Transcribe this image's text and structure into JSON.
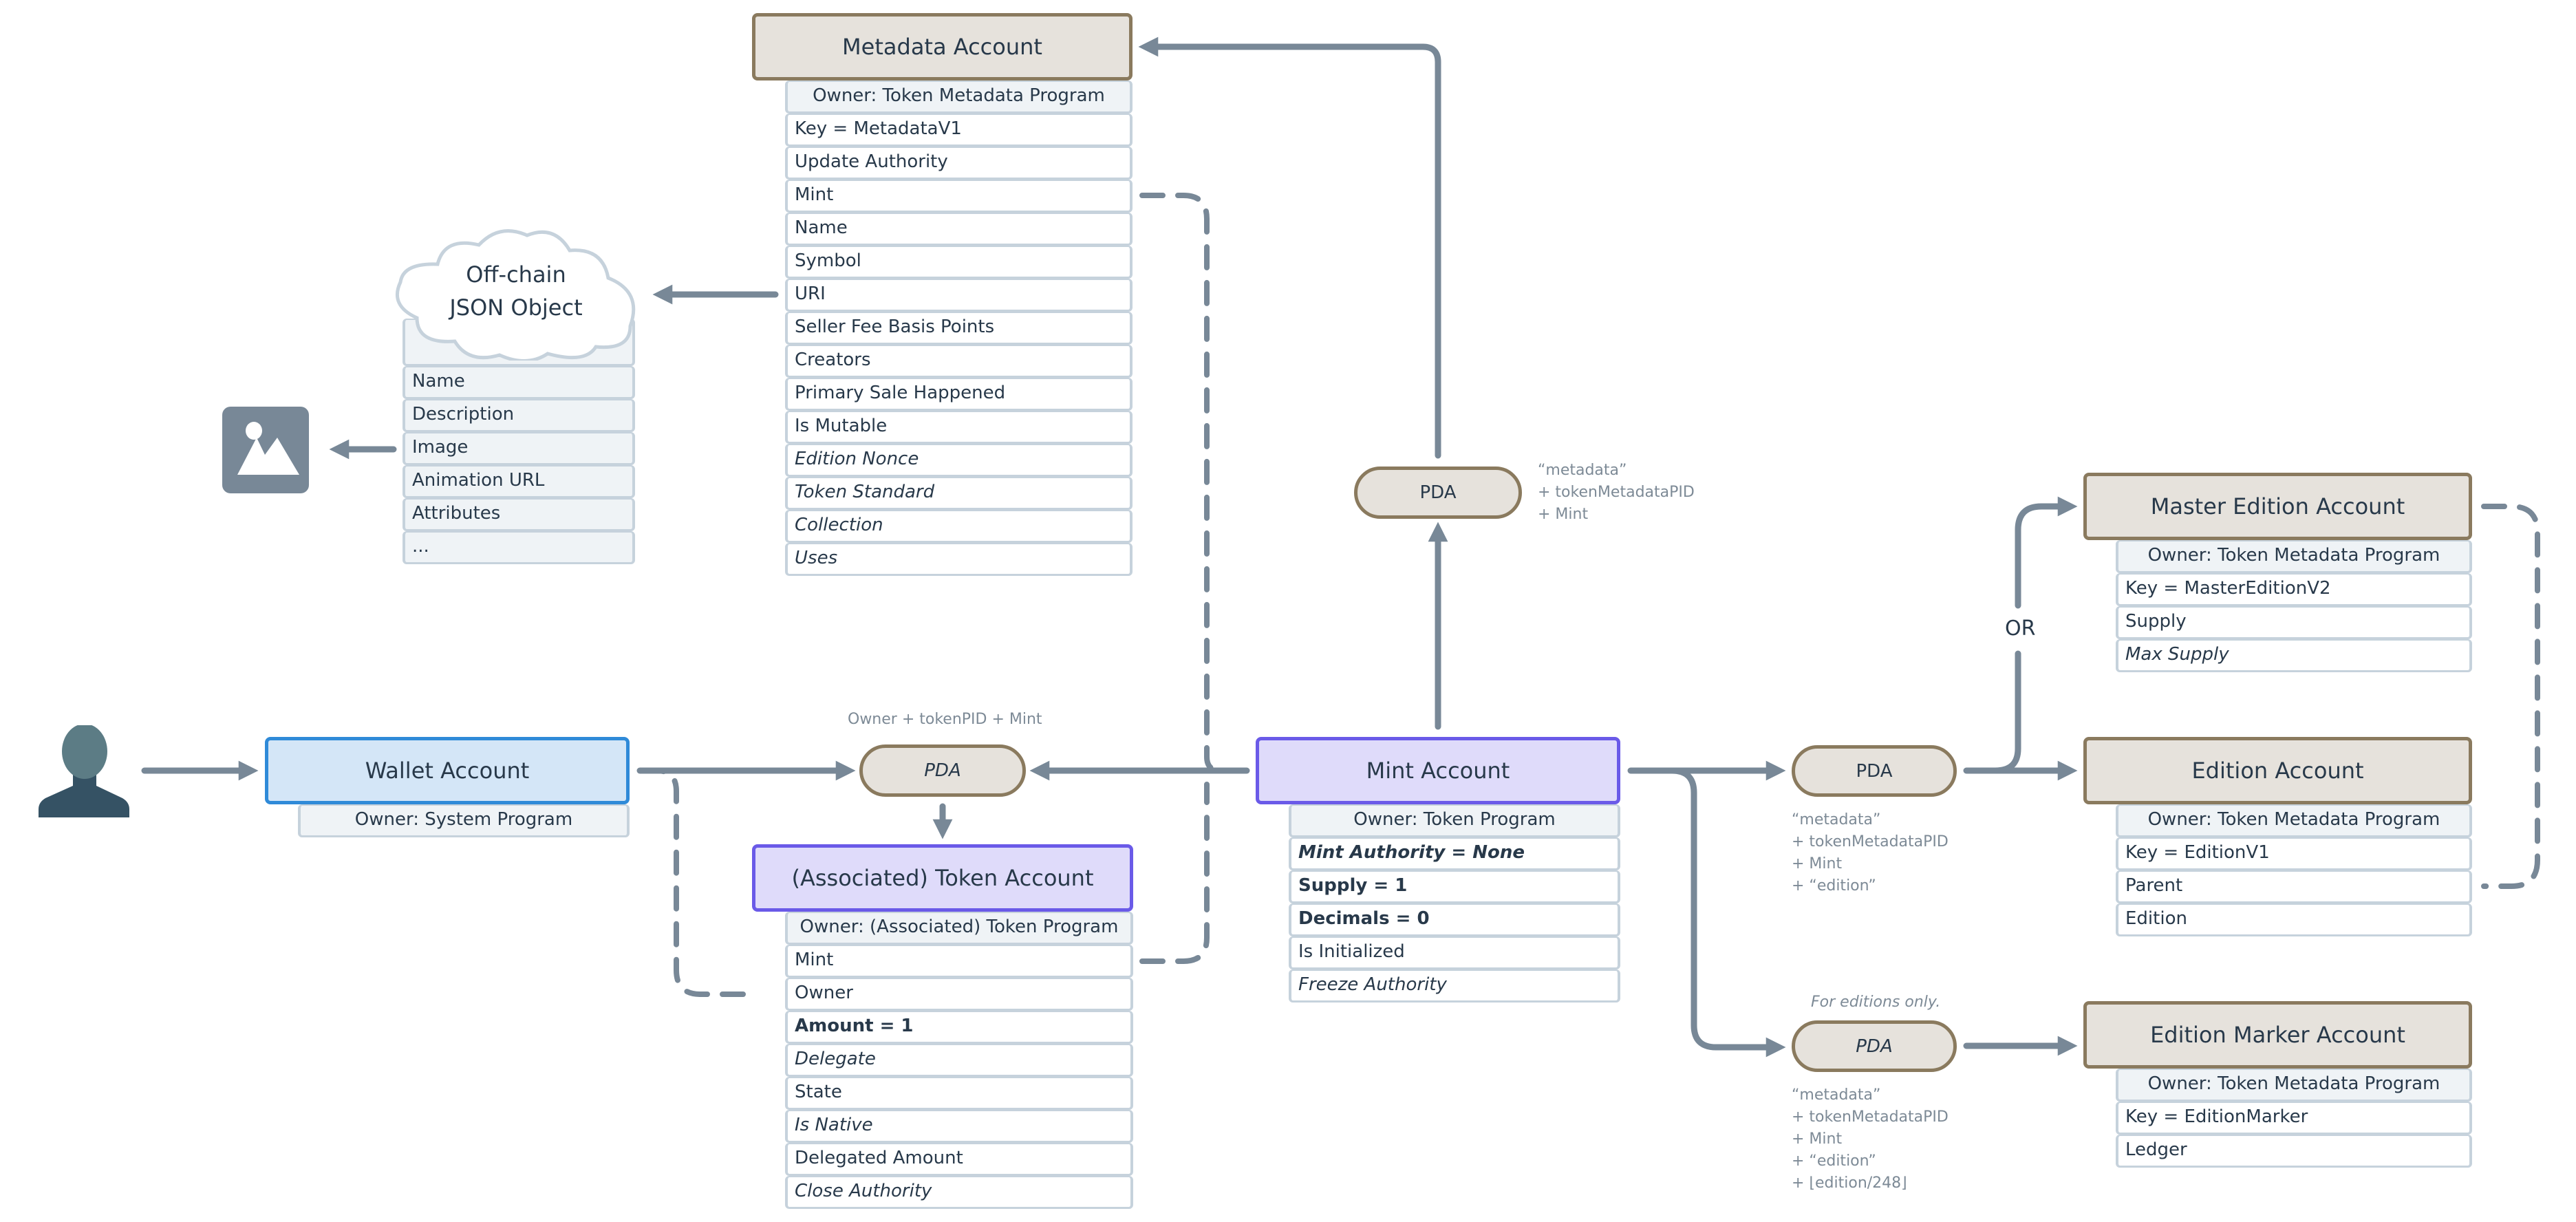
{
  "metadata_account": {
    "title": "Metadata Account",
    "owner": "Owner: Token Metadata Program",
    "fields": [
      {
        "label": "Key = MetadataV1",
        "style": "normal"
      },
      {
        "label": "Update Authority",
        "style": "normal"
      },
      {
        "label": "Mint",
        "style": "normal"
      },
      {
        "label": "Name",
        "style": "normal"
      },
      {
        "label": "Symbol",
        "style": "normal"
      },
      {
        "label": "URI",
        "style": "normal"
      },
      {
        "label": "Seller Fee Basis Points",
        "style": "normal"
      },
      {
        "label": "Creators",
        "style": "normal"
      },
      {
        "label": "Primary Sale Happened",
        "style": "normal"
      },
      {
        "label": "Is Mutable",
        "style": "normal"
      },
      {
        "label": "Edition Nonce",
        "style": "italic"
      },
      {
        "label": "Token Standard",
        "style": "italic"
      },
      {
        "label": "Collection",
        "style": "italic"
      },
      {
        "label": "Uses",
        "style": "italic"
      }
    ]
  },
  "offchain_json": {
    "title_line1": "Off-chain",
    "title_line2": "JSON Object",
    "fields": [
      "Name",
      "Description",
      "Image",
      "Animation URL",
      "Attributes",
      "..."
    ]
  },
  "image_icon": "image-icon",
  "user_icon": "user-icon",
  "wallet_account": {
    "title": "Wallet Account",
    "owner": "Owner: System Program"
  },
  "token_pda": {
    "label": "PDA",
    "seeds": "Owner + tokenPID + Mint"
  },
  "token_account": {
    "title": "(Associated) Token Account",
    "owner": "Owner: (Associated) Token Program",
    "fields": [
      {
        "label": "Mint",
        "style": "normal"
      },
      {
        "label": "Owner",
        "style": "normal"
      },
      {
        "label": "Amount = 1",
        "style": "bold"
      },
      {
        "label": "Delegate",
        "style": "italic"
      },
      {
        "label": "State",
        "style": "normal"
      },
      {
        "label": "Is Native",
        "style": "italic"
      },
      {
        "label": "Delegated Amount",
        "style": "normal"
      },
      {
        "label": "Close Authority",
        "style": "italic"
      }
    ]
  },
  "mint_account": {
    "title": "Mint Account",
    "owner": "Owner: Token Program",
    "fields": [
      {
        "label": "Mint Authority = None",
        "style": "bold-italic"
      },
      {
        "label": "Supply = 1",
        "style": "bold"
      },
      {
        "label": "Decimals = 0",
        "style": "bold"
      },
      {
        "label": "Is Initialized",
        "style": "normal"
      },
      {
        "label": "Freeze Authority",
        "style": "italic"
      }
    ]
  },
  "metadata_pda": {
    "label": "PDA",
    "seeds": "“metadata”\n+ tokenMetadataPID\n+ Mint"
  },
  "edition_pda": {
    "label": "PDA",
    "seeds": "“metadata”\n+ tokenMetadataPID\n+ Mint\n+ “edition”"
  },
  "or_label": "OR",
  "master_edition_account": {
    "title": "Master Edition Account",
    "owner": "Owner: Token Metadata Program",
    "fields": [
      {
        "label": "Key = MasterEditionV2",
        "style": "normal"
      },
      {
        "label": "Supply",
        "style": "normal"
      },
      {
        "label": "Max Supply",
        "style": "italic"
      }
    ]
  },
  "edition_account": {
    "title": "Edition Account",
    "owner": "Owner: Token Metadata Program",
    "fields": [
      {
        "label": "Key = EditionV1",
        "style": "normal"
      },
      {
        "label": "Parent",
        "style": "normal"
      },
      {
        "label": "Edition",
        "style": "normal"
      }
    ]
  },
  "edition_marker_pda": {
    "label": "PDA",
    "note": "For editions only.",
    "seeds": "“metadata”\n+ tokenMetadataPID\n+ Mint\n+ “edition”\n+ ⌊edition/248⌋"
  },
  "edition_marker_account": {
    "title": "Edition Marker Account",
    "owner": "Owner: Token Metadata Program",
    "fields": [
      {
        "label": "Key = EditionMarker",
        "style": "normal"
      },
      {
        "label": "Ledger",
        "style": "normal"
      }
    ]
  },
  "colors": {
    "arrow": "#788897",
    "tan_fill": "#e6e2dc",
    "tan_border": "#8a7a5e",
    "purple_fill": "#dfdbfa",
    "purple_border": "#6a5ae8",
    "blue_fill": "#d4e6f7",
    "blue_border": "#2f8ad8"
  }
}
